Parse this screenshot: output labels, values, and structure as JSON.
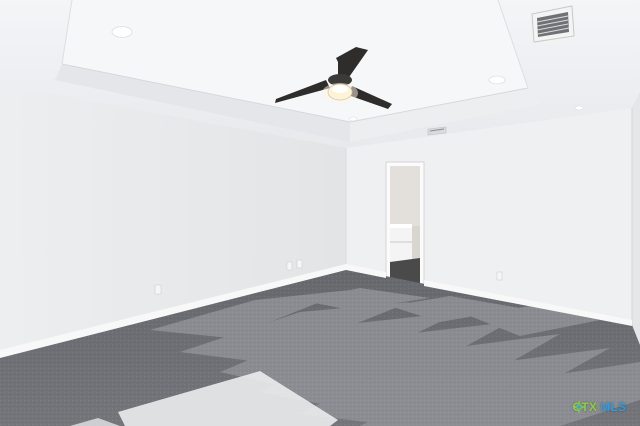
{
  "scene": {
    "description_hidden": "",
    "colors": {
      "ceiling": "#f2f3f5",
      "left_wall": "#e7e8ea",
      "back_wall": "#eef0f2",
      "right_wall": "#e9ebed",
      "carpet_dark": "#5f6166",
      "carpet_light": "#8d8f94",
      "baseboard": "#f7f7f7",
      "fan_blade": "#2e2d2c",
      "light_glow": "#fff8e6",
      "accent_green": "#8ccd3f",
      "accent_blue": "#2f9be0"
    },
    "icons": [
      "ceiling-fan-icon",
      "recessed-light-icon",
      "air-vent-icon",
      "outlet-icon"
    ]
  },
  "watermark": {
    "part_a": "CTX",
    "part_b": "MLS"
  }
}
